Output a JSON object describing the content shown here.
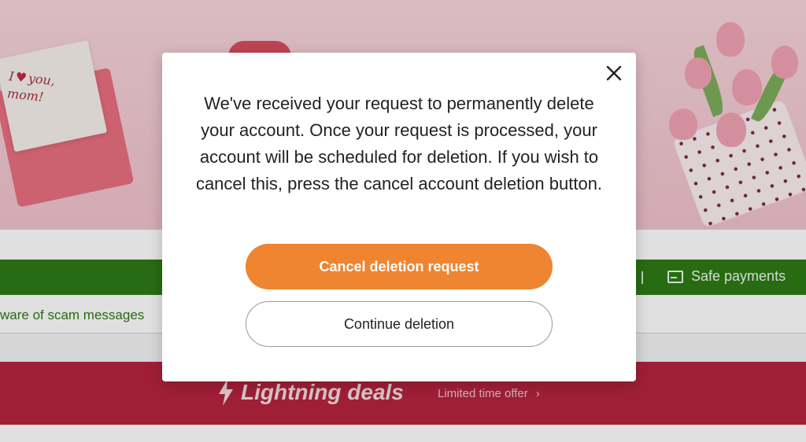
{
  "hero": {
    "card_text_line1": "I",
    "card_text_heart": "♥",
    "card_text_after_heart": "you,",
    "card_text_line2": "mom!"
  },
  "nav": {
    "separator": "|",
    "safe_payments_label": "Safe payments",
    "safe_payments_icon": "card-icon"
  },
  "notice": {
    "scam_text": "ware of scam messages"
  },
  "deals": {
    "title": "Lightning deals",
    "subtitle": "Limited time offer",
    "subtitle_chevron": "›",
    "icon": "lightning-icon"
  },
  "modal": {
    "close_icon": "close-icon",
    "message": "We've received your request to permanently delete your account. Once your request is processed, your account will be scheduled for deletion. If you wish to cancel this, press the cancel account deletion button.",
    "primary_button_label": "Cancel deletion request",
    "secondary_button_label": "Continue deletion"
  },
  "colors": {
    "primary_button": "#ef8431",
    "green_bar": "#2d7b16",
    "deals_bar": "#b5243f",
    "hero_bg": "#f3c9d2"
  }
}
